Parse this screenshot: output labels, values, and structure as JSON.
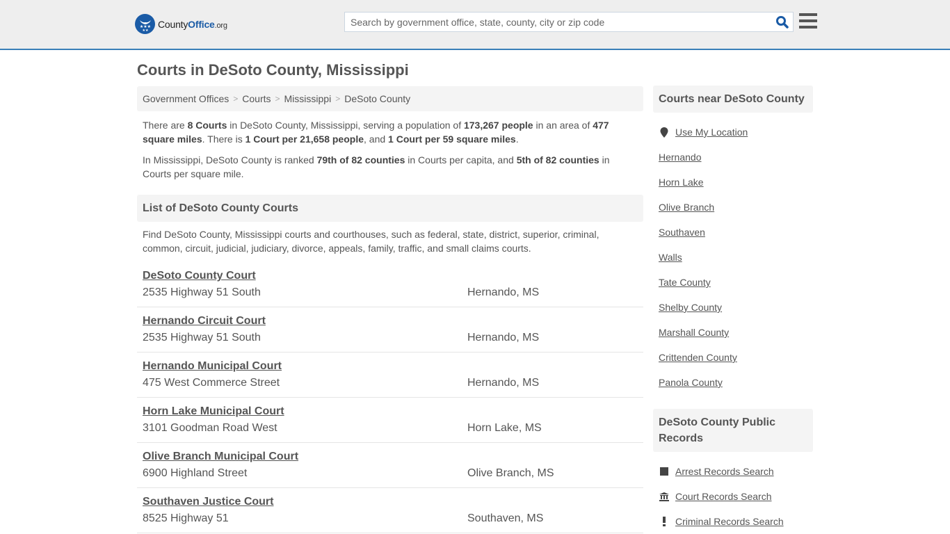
{
  "header": {
    "logo": {
      "brand_main": "County",
      "brand_accent": "Office",
      "brand_tld": ".org"
    },
    "search": {
      "placeholder": "Search by government office, state, county, city or zip code",
      "value": ""
    },
    "icons": {
      "search": "search-icon",
      "menu": "hamburger-menu-icon"
    }
  },
  "page": {
    "title": "Courts in DeSoto County, Mississippi",
    "breadcrumb": [
      "Government Offices",
      "Courts",
      "Mississippi",
      "DeSoto County"
    ],
    "intro": {
      "p1": {
        "t1": "There are ",
        "b1": "8 Courts",
        "t2": " in DeSoto County, Mississippi, serving a population of ",
        "b2": "173,267 people",
        "t3": " in an area of ",
        "b3": "477 square miles",
        "t4": ". There is ",
        "b4": "1 Court per 21,658 people",
        "t5": ", and ",
        "b5": "1 Court per 59 square miles",
        "t6": "."
      },
      "p2": {
        "t1": "In Mississippi, DeSoto County is ranked ",
        "b1": "79th of 82 counties",
        "t2": " in Courts per capita, and ",
        "b2": "5th of 82 counties",
        "t3": " in Courts per square mile."
      }
    },
    "list_section": {
      "title": "List of DeSoto County Courts",
      "description": "Find DeSoto County, Mississippi courts and courthouses, such as federal, state, district, superior, criminal, common, circuit, judicial, judiciary, divorce, appeals, family, traffic, and small claims courts."
    },
    "courts": [
      {
        "name": "DeSoto County Court",
        "address": "2535 Highway 51 South",
        "city": "Hernando, MS"
      },
      {
        "name": "Hernando Circuit Court",
        "address": "2535 Highway 51 South",
        "city": "Hernando, MS"
      },
      {
        "name": "Hernando Municipal Court",
        "address": "475 West Commerce Street",
        "city": "Hernando, MS"
      },
      {
        "name": "Horn Lake Municipal Court",
        "address": "3101 Goodman Road West",
        "city": "Horn Lake, MS"
      },
      {
        "name": "Olive Branch Municipal Court",
        "address": "6900 Highland Street",
        "city": "Olive Branch, MS"
      },
      {
        "name": "Southaven Justice Court",
        "address": "8525 Highway 51",
        "city": "Southaven, MS"
      }
    ]
  },
  "sidebar": {
    "nearby": {
      "title": "Courts near DeSoto County",
      "use_location": {
        "label": "Use My Location",
        "icon": "map-marker-icon"
      },
      "links": [
        "Hernando",
        "Horn Lake",
        "Olive Branch",
        "Southaven",
        "Walls",
        "Tate County",
        "Shelby County",
        "Marshall County",
        "Crittenden County",
        "Panola County"
      ]
    },
    "records": {
      "title": "DeSoto County Public Records",
      "links": [
        {
          "label": "Arrest Records Search",
          "icon": "square-icon"
        },
        {
          "label": "Court Records Search",
          "icon": "courthouse-icon"
        },
        {
          "label": "Criminal Records Search",
          "icon": "exclamation-icon"
        }
      ]
    }
  },
  "colors": {
    "brand_blue": "#1a5ba6",
    "header_border": "#3a7fb8",
    "header_bg": "#eeeeee",
    "text": "#555555",
    "panel_bg": "#f4f4f4"
  }
}
